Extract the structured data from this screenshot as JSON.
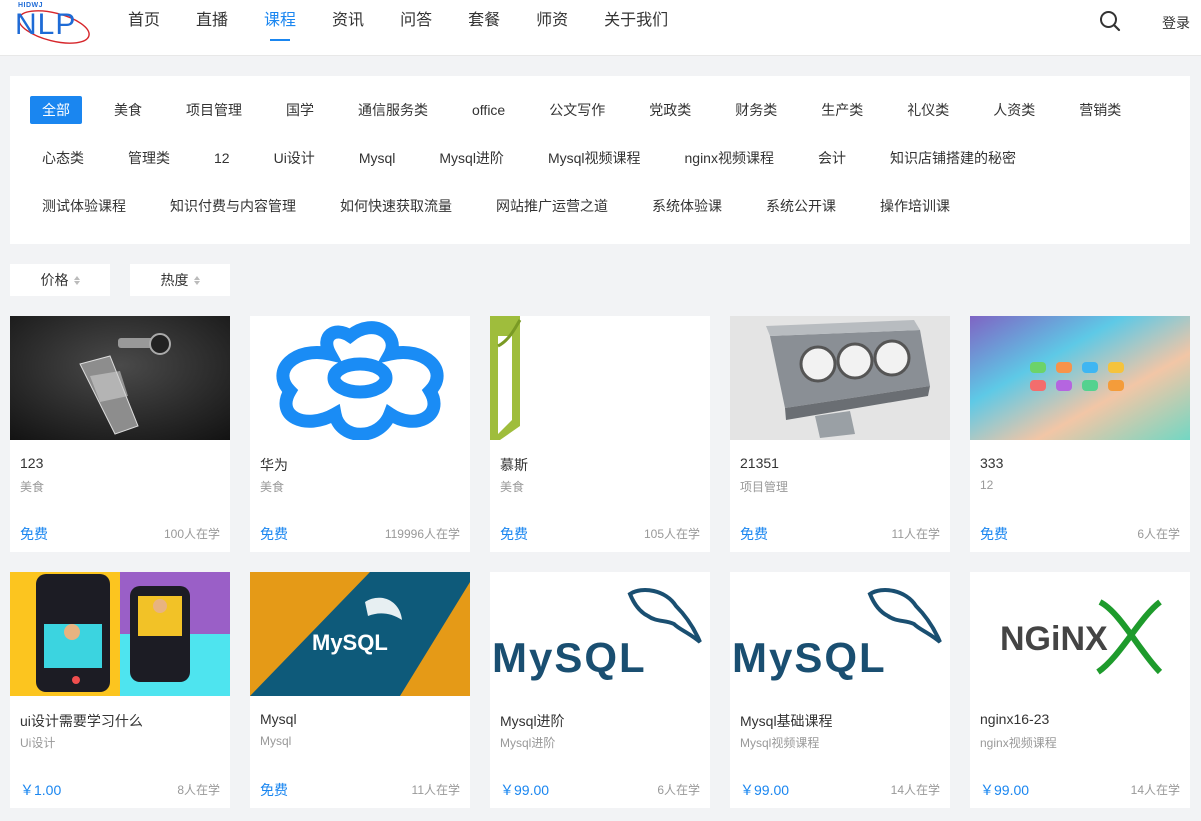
{
  "header": {
    "logo_tag": "HIDWJ",
    "logo_text": "NLP",
    "nav": [
      "首页",
      "直播",
      "课程",
      "资讯",
      "问答",
      "套餐",
      "师资",
      "关于我们"
    ],
    "active_index": 2,
    "login": "登录"
  },
  "categories": [
    "全部",
    "美食",
    "项目管理",
    "国学",
    "通信服务类",
    "office",
    "公文写作",
    "党政类",
    "财务类",
    "生产类",
    "礼仪类",
    "人资类",
    "营销类",
    "心态类",
    "管理类",
    "12",
    "Ui设计",
    "Mysql",
    "Mysql进阶",
    "Mysql视频课程",
    "nginx视频课程",
    "会计",
    "知识店铺搭建的秘密",
    "测试体验课程",
    "知识付费与内容管理",
    "如何快速获取流量",
    "网站推广运营之道",
    "系统体验课",
    "系统公开课",
    "操作培训课"
  ],
  "sort": {
    "price": "价格",
    "hot": "热度"
  },
  "courses": [
    {
      "title": "123",
      "category": "美食",
      "price": "免费",
      "learners": "100人在学",
      "thumb": "pedal"
    },
    {
      "title": "华为",
      "category": "美食",
      "price": "免费",
      "learners": "119996人在学",
      "thumb": "flower"
    },
    {
      "title": "慕斯",
      "category": "美食",
      "price": "免费",
      "learners": "105人在学",
      "thumb": "green"
    },
    {
      "title": "21351",
      "category": "项目管理",
      "price": "免费",
      "learners": "11人在学",
      "thumb": "lamp"
    },
    {
      "title": "333",
      "category": "12",
      "price": "免费",
      "learners": "6人在学",
      "thumb": "gradient"
    },
    {
      "title": "ui设计需要学习什么",
      "category": "Ui设计",
      "price": "￥1.00",
      "learners": "8人在学",
      "thumb": "phones"
    },
    {
      "title": "Mysql",
      "category": "Mysql",
      "price": "免费",
      "learners": "11人在学",
      "thumb": "mysql-banner",
      "logo_text": "MySQL"
    },
    {
      "title": "Mysql进阶",
      "category": "Mysql进阶",
      "price": "￥99.00",
      "learners": "6人在学",
      "thumb": "mysql-logo",
      "logo_text": "MySQL"
    },
    {
      "title": "Mysql基础课程",
      "category": "Mysql视频课程",
      "price": "￥99.00",
      "learners": "14人在学",
      "thumb": "mysql-logo",
      "logo_text": "MySQL"
    },
    {
      "title": "nginx16-23",
      "category": "nginx视频课程",
      "price": "￥99.00",
      "learners": "14人在学",
      "thumb": "nginx",
      "logo_text": "NGiNX"
    }
  ]
}
